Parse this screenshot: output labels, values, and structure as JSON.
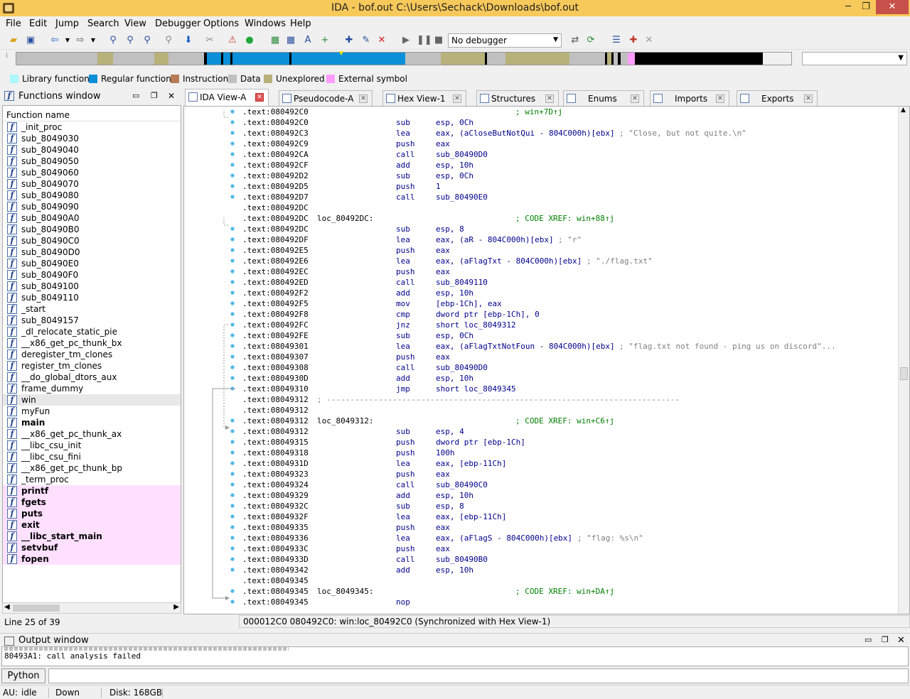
{
  "window": {
    "title": "IDA - bof.out C:\\Users\\Sechack\\Downloads\\bof.out",
    "minimize": "─",
    "maximize": "❐",
    "close": "✕"
  },
  "menu": [
    "File",
    "Edit",
    "Jump",
    "Search",
    "View",
    "Debugger",
    "Options",
    "Windows",
    "Help"
  ],
  "toolbar": {
    "debugger_select": "No debugger"
  },
  "legend": [
    {
      "label": "Library function",
      "color": "#aef7ff"
    },
    {
      "label": "Regular function",
      "color": "#0c8fd9"
    },
    {
      "label": "Instruction",
      "color": "#b77a56"
    },
    {
      "label": "Data",
      "color": "#c0c0c0"
    },
    {
      "label": "Unexplored",
      "color": "#b8b27a"
    },
    {
      "label": "External symbol",
      "color": "#ff9cff"
    }
  ],
  "functions_window": {
    "title": "Functions window",
    "column": "Function name",
    "status": "Line 25 of 39",
    "items": [
      {
        "name": "_init_proc",
        "style": ""
      },
      {
        "name": "sub_8049030",
        "style": ""
      },
      {
        "name": "sub_8049040",
        "style": ""
      },
      {
        "name": "sub_8049050",
        "style": ""
      },
      {
        "name": "sub_8049060",
        "style": ""
      },
      {
        "name": "sub_8049070",
        "style": ""
      },
      {
        "name": "sub_8049080",
        "style": ""
      },
      {
        "name": "sub_8049090",
        "style": ""
      },
      {
        "name": "sub_80490A0",
        "style": ""
      },
      {
        "name": "sub_80490B0",
        "style": ""
      },
      {
        "name": "sub_80490C0",
        "style": ""
      },
      {
        "name": "sub_80490D0",
        "style": ""
      },
      {
        "name": "sub_80490E0",
        "style": ""
      },
      {
        "name": "sub_80490F0",
        "style": ""
      },
      {
        "name": "sub_8049100",
        "style": ""
      },
      {
        "name": "sub_8049110",
        "style": ""
      },
      {
        "name": "_start",
        "style": ""
      },
      {
        "name": "sub_8049157",
        "style": ""
      },
      {
        "name": "_dl_relocate_static_pie",
        "style": ""
      },
      {
        "name": "__x86_get_pc_thunk_bx",
        "style": ""
      },
      {
        "name": "deregister_tm_clones",
        "style": ""
      },
      {
        "name": "register_tm_clones",
        "style": ""
      },
      {
        "name": "__do_global_dtors_aux",
        "style": ""
      },
      {
        "name": "frame_dummy",
        "style": ""
      },
      {
        "name": "win",
        "style": "sel"
      },
      {
        "name": "myFun",
        "style": ""
      },
      {
        "name": "main",
        "style": "bold"
      },
      {
        "name": "__x86_get_pc_thunk_ax",
        "style": ""
      },
      {
        "name": "__libc_csu_init",
        "style": ""
      },
      {
        "name": "__libc_csu_fini",
        "style": ""
      },
      {
        "name": "__x86_get_pc_thunk_bp",
        "style": ""
      },
      {
        "name": "_term_proc",
        "style": ""
      },
      {
        "name": "printf",
        "style": "bold ext"
      },
      {
        "name": "fgets",
        "style": "bold ext"
      },
      {
        "name": "puts",
        "style": "bold ext"
      },
      {
        "name": "exit",
        "style": "bold ext"
      },
      {
        "name": "__libc_start_main",
        "style": "bold ext"
      },
      {
        "name": "setvbuf",
        "style": "bold ext"
      },
      {
        "name": "fopen",
        "style": "bold ext"
      }
    ]
  },
  "tabs": [
    {
      "label": "IDA View-A",
      "active": true
    },
    {
      "label": "Pseudocode-A",
      "active": false
    },
    {
      "label": "Hex View-1",
      "active": false
    },
    {
      "label": "Structures",
      "active": false
    },
    {
      "label": "Enums",
      "active": false
    },
    {
      "label": "Imports",
      "active": false
    },
    {
      "label": "Exports",
      "active": false
    }
  ],
  "listing": [
    {
      "a": ".text:080492C0",
      "l": "",
      "m": "",
      "o": "",
      "c": "",
      "x": "; win+7D↑j"
    },
    {
      "a": ".text:080492C0",
      "l": "",
      "m": "sub",
      "o": "esp, 0Ch",
      "c": "",
      "x": ""
    },
    {
      "a": ".text:080492C3",
      "l": "",
      "m": "lea",
      "o": "eax, (aCloseButNotQui - 804C000h)[ebx]",
      "c": "; \"Close, but not quite.\\n\"",
      "x": ""
    },
    {
      "a": ".text:080492C9",
      "l": "",
      "m": "push",
      "o": "eax",
      "c": "",
      "x": ""
    },
    {
      "a": ".text:080492CA",
      "l": "",
      "m": "call",
      "o": "sub_80490D0",
      "c": "",
      "x": ""
    },
    {
      "a": ".text:080492CF",
      "l": "",
      "m": "add",
      "o": "esp, 10h",
      "c": "",
      "x": ""
    },
    {
      "a": ".text:080492D2",
      "l": "",
      "m": "sub",
      "o": "esp, 0Ch",
      "c": "",
      "x": ""
    },
    {
      "a": ".text:080492D5",
      "l": "",
      "m": "push",
      "o": "1",
      "c": "",
      "x": ""
    },
    {
      "a": ".text:080492D7",
      "l": "",
      "m": "call",
      "o": "sub_80490E0",
      "c": "",
      "x": ""
    },
    {
      "a": ".text:080492DC",
      "l": "",
      "m": "",
      "o": "",
      "c": "",
      "x": ""
    },
    {
      "a": ".text:080492DC",
      "l": "loc_80492DC:",
      "m": "",
      "o": "",
      "c": "",
      "x": "; CODE XREF: win+88↑j"
    },
    {
      "a": ".text:080492DC",
      "l": "",
      "m": "sub",
      "o": "esp, 8",
      "c": "",
      "x": ""
    },
    {
      "a": ".text:080492DF",
      "l": "",
      "m": "lea",
      "o": "eax, (aR - 804C000h)[ebx]",
      "c": "; \"r\"",
      "x": ""
    },
    {
      "a": ".text:080492E5",
      "l": "",
      "m": "push",
      "o": "eax",
      "c": "",
      "x": ""
    },
    {
      "a": ".text:080492E6",
      "l": "",
      "m": "lea",
      "o": "eax, (aFlagTxt - 804C000h)[ebx]",
      "c": "; \"./flag.txt\"",
      "x": ""
    },
    {
      "a": ".text:080492EC",
      "l": "",
      "m": "push",
      "o": "eax",
      "c": "",
      "x": ""
    },
    {
      "a": ".text:080492ED",
      "l": "",
      "m": "call",
      "o": "sub_8049110",
      "c": "",
      "x": ""
    },
    {
      "a": ".text:080492F2",
      "l": "",
      "m": "add",
      "o": "esp, 10h",
      "c": "",
      "x": ""
    },
    {
      "a": ".text:080492F5",
      "l": "",
      "m": "mov",
      "o": "[ebp-1Ch], eax",
      "c": "",
      "x": ""
    },
    {
      "a": ".text:080492F8",
      "l": "",
      "m": "cmp",
      "o": "dword ptr [ebp-1Ch], 0",
      "c": "",
      "x": ""
    },
    {
      "a": ".text:080492FC",
      "l": "",
      "m": "jnz",
      "o": "short loc_8049312",
      "c": "",
      "x": ""
    },
    {
      "a": ".text:080492FE",
      "l": "",
      "m": "sub",
      "o": "esp, 0Ch",
      "c": "",
      "x": ""
    },
    {
      "a": ".text:08049301",
      "l": "",
      "m": "lea",
      "o": "eax, (aFlagTxtNotFoun - 804C000h)[ebx]",
      "c": "; \"flag.txt not found - ping us on discord\"...",
      "x": ""
    },
    {
      "a": ".text:08049307",
      "l": "",
      "m": "push",
      "o": "eax",
      "c": "",
      "x": ""
    },
    {
      "a": ".text:08049308",
      "l": "",
      "m": "call",
      "o": "sub_80490D0",
      "c": "",
      "x": ""
    },
    {
      "a": ".text:0804930D",
      "l": "",
      "m": "add",
      "o": "esp, 10h",
      "c": "",
      "x": ""
    },
    {
      "a": ".text:08049310",
      "l": "",
      "m": "jmp",
      "o": "short loc_8049345",
      "c": "",
      "x": ""
    },
    {
      "a": ".text:08049312",
      "l": "; ---------------------------------------------------------------------------",
      "m": "",
      "o": "",
      "c": "",
      "x": ""
    },
    {
      "a": ".text:08049312",
      "l": "",
      "m": "",
      "o": "",
      "c": "",
      "x": ""
    },
    {
      "a": ".text:08049312",
      "l": "loc_8049312:",
      "m": "",
      "o": "",
      "c": "",
      "x": "; CODE XREF: win+C6↑j"
    },
    {
      "a": ".text:08049312",
      "l": "",
      "m": "sub",
      "o": "esp, 4",
      "c": "",
      "x": ""
    },
    {
      "a": ".text:08049315",
      "l": "",
      "m": "push",
      "o": "dword ptr [ebp-1Ch]",
      "c": "",
      "x": ""
    },
    {
      "a": ".text:08049318",
      "l": "",
      "m": "push",
      "o": "100h",
      "c": "",
      "x": ""
    },
    {
      "a": ".text:0804931D",
      "l": "",
      "m": "lea",
      "o": "eax, [ebp-11Ch]",
      "c": "",
      "x": ""
    },
    {
      "a": ".text:08049323",
      "l": "",
      "m": "push",
      "o": "eax",
      "c": "",
      "x": ""
    },
    {
      "a": ".text:08049324",
      "l": "",
      "m": "call",
      "o": "sub_80490C0",
      "c": "",
      "x": ""
    },
    {
      "a": ".text:08049329",
      "l": "",
      "m": "add",
      "o": "esp, 10h",
      "c": "",
      "x": ""
    },
    {
      "a": ".text:0804932C",
      "l": "",
      "m": "sub",
      "o": "esp, 8",
      "c": "",
      "x": ""
    },
    {
      "a": ".text:0804932F",
      "l": "",
      "m": "lea",
      "o": "eax, [ebp-11Ch]",
      "c": "",
      "x": ""
    },
    {
      "a": ".text:08049335",
      "l": "",
      "m": "push",
      "o": "eax",
      "c": "",
      "x": ""
    },
    {
      "a": ".text:08049336",
      "l": "",
      "m": "lea",
      "o": "eax, (aFlagS - 804C000h)[ebx]",
      "c": "; \"flag: %s\\n\"",
      "x": ""
    },
    {
      "a": ".text:0804933C",
      "l": "",
      "m": "push",
      "o": "eax",
      "c": "",
      "x": ""
    },
    {
      "a": ".text:0804933D",
      "l": "",
      "m": "call",
      "o": "sub_80490B0",
      "c": "",
      "x": ""
    },
    {
      "a": ".text:08049342",
      "l": "",
      "m": "add",
      "o": "esp, 10h",
      "c": "",
      "x": ""
    },
    {
      "a": ".text:08049345",
      "l": "",
      "m": "",
      "o": "",
      "c": "",
      "x": ""
    },
    {
      "a": ".text:08049345",
      "l": "loc_8049345:",
      "m": "",
      "o": "",
      "c": "",
      "x": "; CODE XREF: win+DA↑j"
    },
    {
      "a": ".text:08049345",
      "l": "",
      "m": "nop",
      "o": "",
      "c": "",
      "x": ""
    }
  ],
  "ida_status": "000012C0 080492C0: win:loc_80492C0 (Synchronized with Hex View-1)",
  "output_window": {
    "title": "Output window",
    "lines": [
      "80493A1: call analysis failed"
    ]
  },
  "python_button": "Python",
  "statusbar": {
    "au": "AU:",
    "state": "idle",
    "dir": "Down",
    "disk": "Disk: 168GB"
  }
}
